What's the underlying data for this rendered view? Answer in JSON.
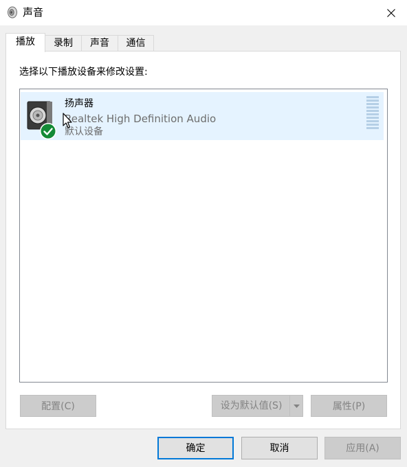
{
  "window": {
    "title": "声音",
    "title_icon": "speaker-icon",
    "close_icon": "close-icon"
  },
  "tabs": [
    {
      "label": "播放",
      "active": true
    },
    {
      "label": "录制",
      "active": false
    },
    {
      "label": "声音",
      "active": false
    },
    {
      "label": "通信",
      "active": false
    }
  ],
  "playback": {
    "instruction": "选择以下播放设备来修改设置:",
    "devices": [
      {
        "name": "扬声器",
        "description": "Realtek High Definition Audio",
        "status": "默认设备",
        "icon": "speaker-icon",
        "badge_icon": "green-check-icon",
        "selected": true
      }
    ]
  },
  "panel_buttons": {
    "configure": "配置(C)",
    "set_default": "设为默认值(S)",
    "properties": "属性(P)"
  },
  "dialog_buttons": {
    "ok": "确定",
    "cancel": "取消",
    "apply": "应用(A)"
  },
  "colors": {
    "selection": "#e5f3ff",
    "check_badge": "#138a36",
    "focus_border": "#0078d7"
  }
}
